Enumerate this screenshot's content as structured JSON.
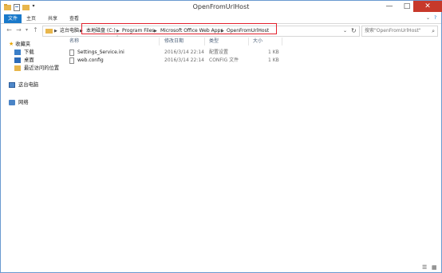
{
  "window": {
    "title": "OpenFromUrlHost"
  },
  "ribbon": {
    "tabs": [
      "文件",
      "主页",
      "共享",
      "查看"
    ]
  },
  "address": {
    "crumbs": [
      "这台电脑",
      "本地磁盘 (C:)",
      "Program Files",
      "Microsoft Office Web Apps",
      "OpenFromUrlHost"
    ]
  },
  "search": {
    "placeholder": "搜索\"OpenFromUrlHost\""
  },
  "nav": {
    "favorites": "收藏夹",
    "downloads": "下载",
    "desktop": "桌面",
    "recent": "最近访问的位置",
    "this_pc": "这台电脑",
    "network": "网络"
  },
  "columns": {
    "name": "名称",
    "modified": "修改日期",
    "type": "类型",
    "size": "大小"
  },
  "files": [
    {
      "name": "Settings_Service.ini",
      "modified": "2016/3/14 22:14",
      "type": "配置设置",
      "size": "1 KB"
    },
    {
      "name": "web.config",
      "modified": "2016/3/14 22:14",
      "type": "CONFIG 文件",
      "size": "1 KB"
    }
  ],
  "colors": {
    "accent": "#1979ca",
    "close": "#c7392b",
    "highlight": "#e3212d",
    "folder": "#e8b64c"
  }
}
